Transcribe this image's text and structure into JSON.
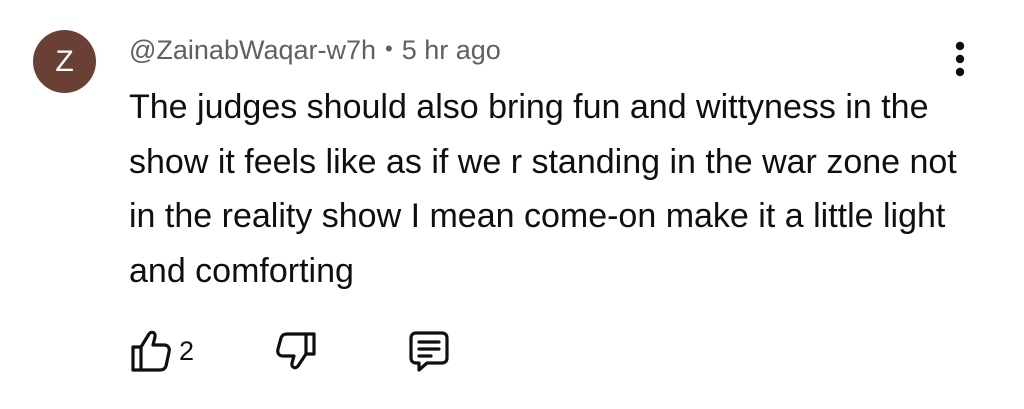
{
  "comment": {
    "avatar_letter": "Z",
    "avatar_color": "#6a4034",
    "handle": "@ZainabWaqar-w7h",
    "separator": "•",
    "time": "5 hr ago",
    "text": "The judges should also bring fun and wittyness in the show it feels like as if we r standing in the war zone not in the reality show I mean come-on make it a little light and comforting",
    "like_count": "2",
    "icons": {
      "more": "more-vert-icon",
      "like": "thumbs-up-icon",
      "dislike": "thumbs-down-icon",
      "reply": "reply-comment-icon"
    }
  }
}
